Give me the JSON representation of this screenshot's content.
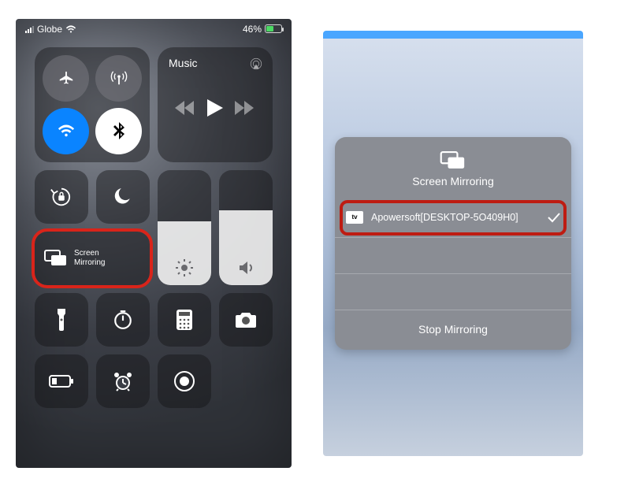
{
  "status_bar": {
    "carrier": "Globe",
    "battery_pct": "46%"
  },
  "connectivity": {
    "airplane": "airplane",
    "cellular": "cellular-data",
    "wifi": "wifi",
    "bluetooth": "bluetooth"
  },
  "music": {
    "title": "Music"
  },
  "screen_mirroring_tile": {
    "label": "Screen\nMirroring"
  },
  "picker": {
    "title": "Screen Mirroring",
    "device": {
      "icon_label": "tv",
      "name": "Apowersoft[DESKTOP-5O409H0]"
    },
    "stop_label": "Stop Mirroring"
  }
}
